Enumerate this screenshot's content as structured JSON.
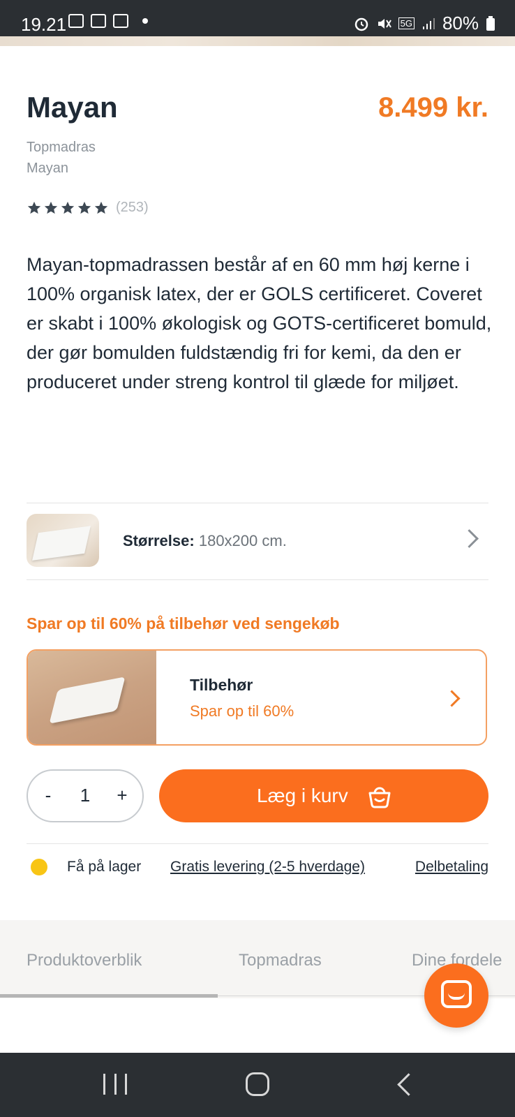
{
  "status_bar": {
    "time": "19.21",
    "battery": "80%",
    "network": "5G"
  },
  "product": {
    "title": "Mayan",
    "price": "8.499 kr.",
    "category": "Topmadras",
    "model": "Mayan",
    "rating": {
      "stars": 5,
      "count": "(253)"
    },
    "description": "Mayan-topmadrassen består af en 60 mm høj kerne i 100% organisk latex, der er GOLS certificeret. Coveret er skabt i 100% økologisk og GOTS-certificeret bomuld, der gør bomulden fuldstændig fri for kemi, da den er produceret under streng kontrol til glæde for miljøet."
  },
  "size_selector": {
    "label": "Størrelse:",
    "value": "180x200 cm."
  },
  "promo": {
    "title": "Spar op til 60% på tilbehør ved sengekøb",
    "card_title": "Tilbehør",
    "card_subtitle": "Spar op til 60%"
  },
  "purchase": {
    "quantity": "1",
    "minus": "-",
    "plus": "+",
    "cart_label": "Læg i kurv"
  },
  "info_row": {
    "stock": "Få på lager",
    "delivery": "Gratis levering (2-5 hverdage)",
    "payment": "Delbetaling"
  },
  "tabs": [
    "Produktoverblik",
    "Topmadras",
    "Dine fordele"
  ],
  "colors": {
    "accent": "#fb6e1e",
    "price": "#f07a24",
    "stock": "#f8c515",
    "text": "#1f2a36"
  }
}
